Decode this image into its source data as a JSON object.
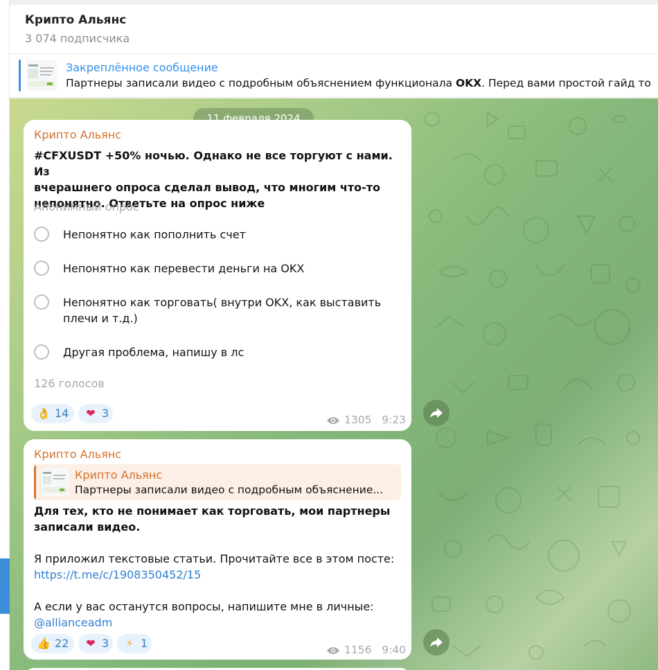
{
  "header": {
    "channel_name": "Крипто Альянс",
    "subscribers": "3 074 подписчика"
  },
  "pinned": {
    "title": "Закреплённое сообщение",
    "text_before": "Партнеры записали видео с подробным объяснением функционала ",
    "text_bold": "OKX",
    "text_after": ".   Перед вами простой гайд то"
  },
  "date_separator": "11 февраля 2024",
  "messages": [
    {
      "sender": "Крипто Альянс",
      "question_lines": [
        "#CFXUSDT +50% ночью. Однако не все торгуют с нами. Из",
        "вчерашнего опроса сделал вывод, что многим что-то",
        "непонятно. Ответьте на опрос ниже"
      ],
      "poll_type": "Анонимный опрос",
      "options": [
        {
          "lines": [
            "Непонятно как пополнить счет"
          ]
        },
        {
          "lines": [
            "Непонятно как перевести деньги на OKX"
          ]
        },
        {
          "lines": [
            "Непонятно как торговать( внутри OKX, как выставить",
            "плечи и т.д.)"
          ]
        },
        {
          "lines": [
            "Другая проблема, напишу в лс"
          ]
        }
      ],
      "votes": "126 голосов",
      "reactions": [
        {
          "emoji": "👌",
          "count": "14"
        },
        {
          "emoji": "❤",
          "count": "3"
        }
      ],
      "views": "1305",
      "time": "9:23"
    },
    {
      "sender": "Крипто Альянс",
      "reply": {
        "title": "Крипто Альянс",
        "text": "Партнеры записали видео с подробным объяснение..."
      },
      "bold_lines": [
        "Для тех, кто не понимает как торговать, мои партнеры",
        "записали видео."
      ],
      "para2": "Я приложил текстовые статьи. Прочитайте все в этом посте:",
      "link1": "https://t.me/c/1908350452/15",
      "para3": "А если у вас останутся вопросы, напишите мне в личные:",
      "link2": "@allianceadm",
      "reactions": [
        {
          "emoji": "👍",
          "count": "22"
        },
        {
          "emoji": "❤",
          "count": "3"
        },
        {
          "emoji": "⚡",
          "count": "1"
        }
      ],
      "views": "1156",
      "time": "9:40"
    }
  ],
  "icons": {
    "share": "share-arrow-icon",
    "eye": "eye-icon",
    "radio": "radio-circle-icon"
  },
  "colors": {
    "accent": "#3390ec",
    "sender": "#d2732d",
    "reaction_bg": "#e8f2fc",
    "heart": "#e0245e"
  }
}
